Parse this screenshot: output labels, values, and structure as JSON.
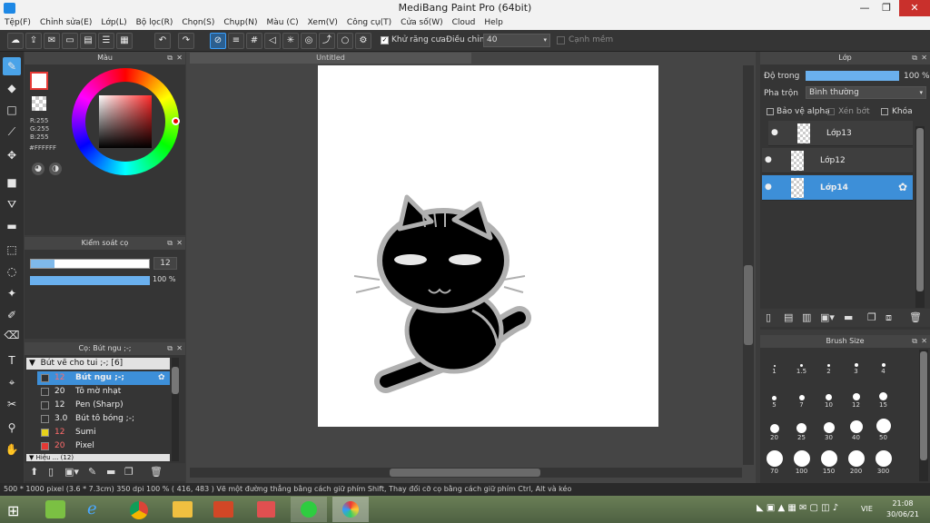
{
  "window": {
    "title": "MediBang Paint Pro (64bit)"
  },
  "menu": [
    "Tệp(F)",
    "Chỉnh sửa(E)",
    "Lớp(L)",
    "Bộ lọc(R)",
    "Chọn(S)",
    "Chụp(N)",
    "Màu (C)",
    "Xem(V)",
    "Công cụ(T)",
    "Cửa số(W)",
    "Cloud",
    "Help"
  ],
  "toolbar": {
    "antialias_label": "Khử răng cưa",
    "adjust_label": "Điều chỉnh",
    "adjust_value": "40",
    "edge_label": "Cạnh mềm"
  },
  "color_panel": {
    "title": "Màu",
    "r": "R:255",
    "g": "G:255",
    "b": "B:255",
    "hex": "#FFFFFF"
  },
  "brush_control": {
    "title": "Kiểm soát cọ",
    "size": "12",
    "opacity": "100 %",
    "size_fraction": 0.2,
    "opacity_fraction": 1.0
  },
  "brush_panel": {
    "title": "Cọ: Bút ngu ;-;",
    "group": "Bút vẽ cho tui ;-; [6]",
    "items": [
      {
        "size": "12",
        "name": "Bút ngu ;-;",
        "color": "#333333",
        "selected": true
      },
      {
        "size": "20",
        "name": "Tô mờ nhạt",
        "color": "#333333",
        "selected": false
      },
      {
        "size": "12",
        "name": "Pen (Sharp)",
        "color": "#333333",
        "selected": false
      },
      {
        "size": "3.0",
        "name": "Bút tô bóng ;-;",
        "color": "#333333",
        "selected": false
      },
      {
        "size": "12",
        "name": "Sumi",
        "color": "#e8d21a",
        "selected": false
      },
      {
        "size": "20",
        "name": "Pixel",
        "color": "#e53935",
        "selected": false
      }
    ],
    "more": "Hiệu ... (12)"
  },
  "canvas": {
    "tab": "Untitled"
  },
  "layer_panel": {
    "title": "Lớp",
    "opacity_label": "Độ trong",
    "opacity_value": "100 %",
    "opacity_fraction": 1.0,
    "blend_label": "Pha trộn",
    "blend_value": "Bình thường",
    "protect_alpha": "Bảo vệ alpha",
    "clipping": "Xén bớt",
    "lock": "Khóa",
    "layers": [
      {
        "name": "Lớp13",
        "selected": false
      },
      {
        "name": "Lớp12",
        "selected": false
      },
      {
        "name": "Lớp14",
        "selected": true
      }
    ]
  },
  "brush_size_panel": {
    "title": "Brush Size",
    "sizes": [
      "1",
      "1.5",
      "2",
      "3",
      "4",
      "5",
      "7",
      "10",
      "12",
      "15",
      "20",
      "25",
      "30",
      "40",
      "50",
      "70",
      "100",
      "150",
      "200",
      "300"
    ]
  },
  "status": {
    "text": "500 * 1000 pixel   (3.6 * 7.3cm)   350 dpi   100 %   ( 416, 483 )   Vẽ một đường thẳng bằng cách giữ phím Shift, Thay đổi cỡ cọ bằng cách giữ phím Ctrl, Alt và kéo"
  },
  "taskbar": {
    "lang": "VIE",
    "time": "21:08",
    "date": "30/06/21"
  }
}
